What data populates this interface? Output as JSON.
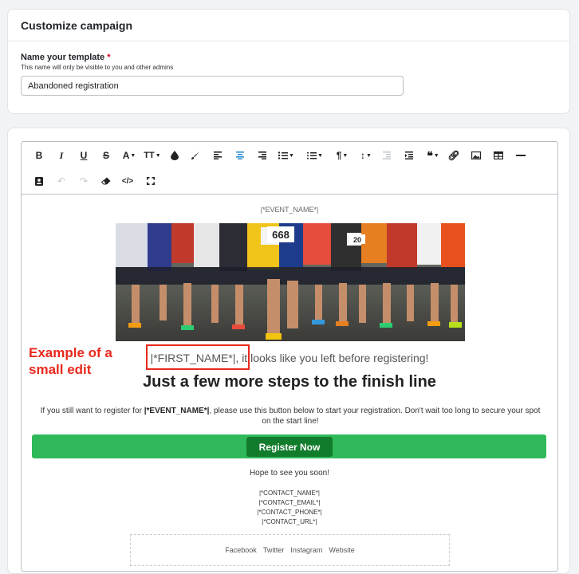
{
  "card": {
    "title": "Customize campaign",
    "name_label": "Name your template",
    "required_mark": "*",
    "name_hint": "This name will only be visible to you and other admins",
    "name_value": "Abandoned registration"
  },
  "toolbar": {
    "bold": "B",
    "italic": "I",
    "underline": "U",
    "strike": "S",
    "font": "A",
    "size": "TT"
  },
  "email": {
    "event_name_tag": "|*EVENT_NAME*|",
    "greeting": "|*FIRST_NAME*|, it looks like you left before registering!",
    "headline": "Just a few more steps to the finish line",
    "body_prefix": "If you still want to register for ",
    "body_tag": "|*EVENT_NAME*|",
    "body_suffix": ", please use this button below to start your registration. Don't wait too long to secure your spot on the start line!",
    "register_label": "Register Now",
    "hope": "Hope to see you soon!",
    "contacts": [
      "|*CONTACT_NAME*|",
      "|*CONTACT_EMAIL*|",
      "|*CONTACT_PHONE*|",
      "|*CONTACT_URL*|"
    ],
    "social": [
      "Facebook",
      "Twitter",
      "Instagram",
      "Website"
    ]
  },
  "annotation": {
    "text_line1": "Example of a",
    "text_line2": "small edit",
    "color": "#e8281d"
  },
  "colors": {
    "accent_green": "#2fb95a",
    "button_green": "#127c2d",
    "active_align": "#2f8fd6"
  }
}
